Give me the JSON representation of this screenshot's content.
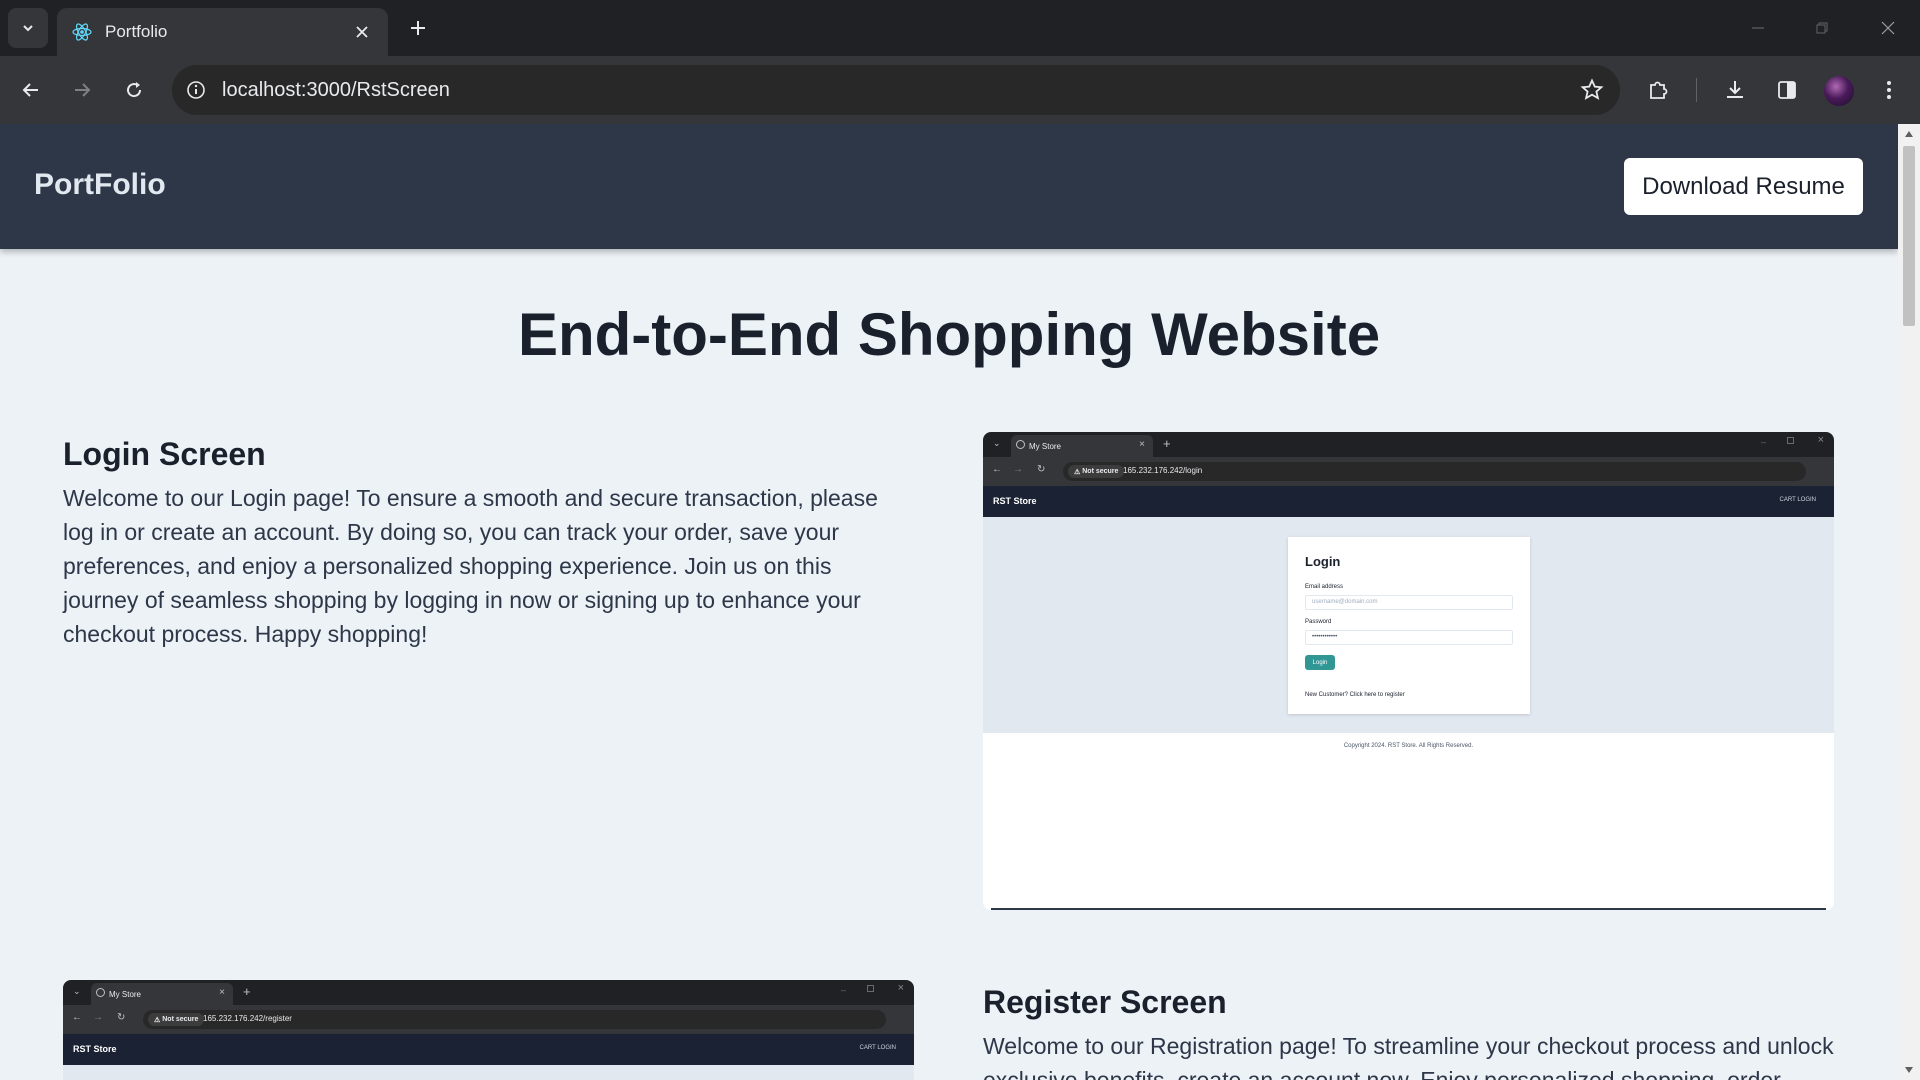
{
  "browser": {
    "tab_title": "Portfolio",
    "url": "localhost:3000/RstScreen"
  },
  "navbar": {
    "brand": "PortFolio",
    "resume_button": "Download Resume",
    "bg_color": "#2d3748"
  },
  "page": {
    "heading": "End-to-End Shopping Website",
    "sections": [
      {
        "title": "Login Screen",
        "text": "Welcome to our Login page! To ensure a smooth and secure transaction, please log in or create an account. By doing so, you can track your order, save your preferences, and enjoy a personalized shopping experience. Join us on this journey of seamless shopping by logging in now or signing up to enhance your checkout process. Happy shopping!"
      },
      {
        "title": "Register Screen",
        "text": "Welcome to our Registration page! To streamline your checkout process and unlock exclusive benefits, create an account now. Enjoy personalized shopping, order"
      }
    ]
  },
  "screenshots": {
    "login": {
      "tab_title": "My Store",
      "not_secure": "Not secure",
      "url": "165.232.176.242/login",
      "store_name": "RST Store",
      "nav_links": "CART   LOGIN",
      "form_title": "Login",
      "email_label": "Email address",
      "email_placeholder": "username@domain.com",
      "password_label": "Password",
      "password_value": "••••••••••••",
      "login_button": "Login",
      "register_link": "New Customer? Click here to register",
      "footer": "Copyright 2024. RST Store. All Rights Reserved."
    },
    "register": {
      "tab_title": "My Store",
      "not_secure": "Not secure",
      "url": "165.232.176.242/register",
      "store_name": "RST Store",
      "nav_links": "CART   LOGIN"
    }
  }
}
